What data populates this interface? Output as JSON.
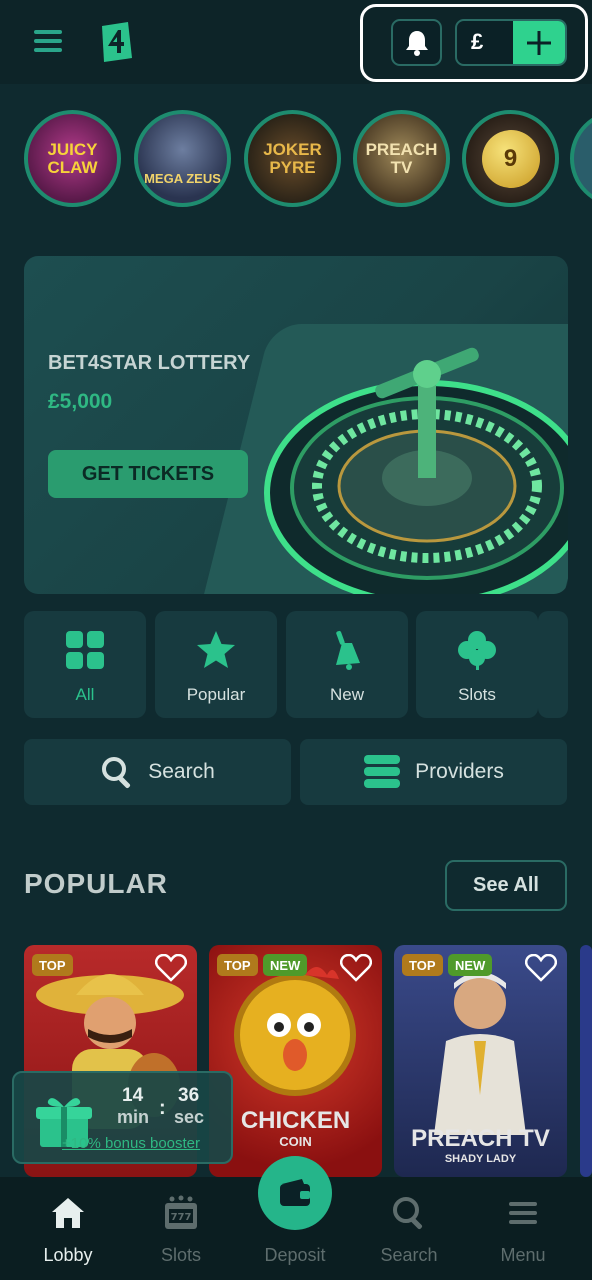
{
  "header": {
    "currency_symbol": "£"
  },
  "stories": [
    {
      "name": "JUICY CLAW"
    },
    {
      "name": "MEGA ZEUS"
    },
    {
      "name": "JOKER PYRE"
    },
    {
      "name": "PREACH TV"
    },
    {
      "name": "9"
    }
  ],
  "banner": {
    "title": "BET4STAR LOTTERY",
    "amount": "£5,000",
    "cta": "GET TICKETS"
  },
  "categories": [
    {
      "label": "All",
      "icon": "grid-icon"
    },
    {
      "label": "Popular",
      "icon": "star-icon"
    },
    {
      "label": "New",
      "icon": "bell-icon"
    },
    {
      "label": "Slots",
      "icon": "clover-icon"
    }
  ],
  "actions": {
    "search": "Search",
    "providers": "Providers"
  },
  "popular": {
    "title": "POPULAR",
    "see_all": "See All",
    "games": [
      {
        "badges": [
          "TOP"
        ],
        "title": ""
      },
      {
        "badges": [
          "TOP",
          "NEW"
        ],
        "title": "CHICKEN",
        "subtitle": "COIN"
      },
      {
        "badges": [
          "TOP",
          "NEW"
        ],
        "title": "PREACH TV",
        "subtitle": "SHADY LADY"
      }
    ]
  },
  "booster": {
    "minutes": "14",
    "min_label": "min",
    "seconds": "36",
    "sec_label": "sec",
    "link": "+10% bonus booster"
  },
  "bottom_nav": {
    "lobby": "Lobby",
    "slots": "Slots",
    "deposit": "Deposit",
    "search": "Search",
    "menu": "Menu"
  },
  "colors": {
    "background": "#0f2a2f",
    "accent": "#2fd28e",
    "panel": "#173a3f"
  }
}
